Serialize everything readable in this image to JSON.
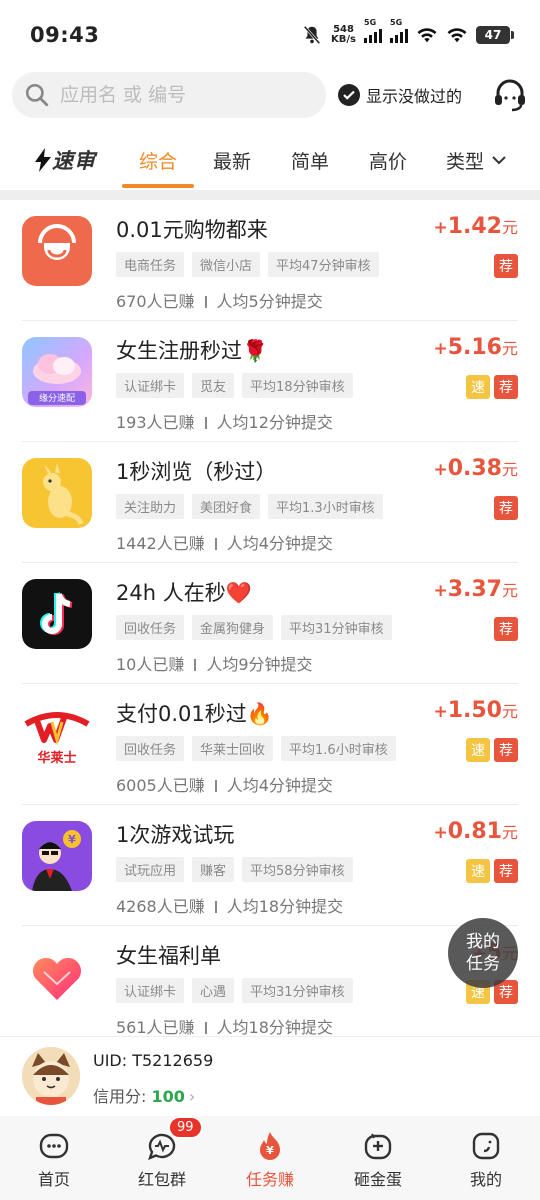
{
  "status_bar": {
    "time": "09:43",
    "speed_value": "548",
    "speed_unit": "KB/s",
    "sig1": "5G",
    "sig2": "5G",
    "battery": "47"
  },
  "search": {
    "placeholder": "应用名 或 编号",
    "toggle_label": "显示没做过的"
  },
  "tabs": {
    "logo": "速审",
    "items": [
      "综合",
      "最新",
      "简单",
      "高价",
      "类型"
    ],
    "active": "综合"
  },
  "tasks": [
    {
      "title": "0.01元购物都来",
      "tags": [
        "电商任务",
        "微信小店",
        "平均47分钟审核"
      ],
      "earned": "670人已赚",
      "avg": "人均5分钟提交",
      "plus": "+",
      "price": "1.42",
      "unit": "元",
      "fast": false,
      "rec": "荐",
      "icon": "shop-icon",
      "color": "#ef6a4c"
    },
    {
      "title": "女生注册秒过🌹",
      "tags": [
        "认证绑卡",
        "觅友",
        "平均18分钟审核"
      ],
      "earned": "193人已赚",
      "avg": "人均12分钟提交",
      "plus": "+",
      "price": "5.16",
      "unit": "元",
      "fast": true,
      "fast_label": "速",
      "rec": "荐",
      "icon": "cloud-heart-icon",
      "color": "#b7a6f3",
      "icon_caption": "缘分速配"
    },
    {
      "title": "1秒浏览（秒过）",
      "tags": [
        "关注助力",
        "美团好食",
        "平均1.3小时审核"
      ],
      "earned": "1442人已赚",
      "avg": "人均4分钟提交",
      "plus": "+",
      "price": "0.38",
      "unit": "元",
      "fast": false,
      "rec": "荐",
      "icon": "kangaroo-icon",
      "color": "#f7c531"
    },
    {
      "title": "24h 人在秒❤️",
      "tags": [
        "回收任务",
        "金属狗健身",
        "平均31分钟审核"
      ],
      "earned": "10人已赚",
      "avg": "人均9分钟提交",
      "plus": "+",
      "price": "3.37",
      "unit": "元",
      "fast": false,
      "rec": "荐",
      "icon": "tiktok-icon",
      "color": "#111111"
    },
    {
      "title": "支付0.01秒过🔥",
      "tags": [
        "回收任务",
        "华莱士回收",
        "平均1.6小时审核"
      ],
      "earned": "6005人已赚",
      "avg": "人均4分钟提交",
      "plus": "+",
      "price": "1.50",
      "unit": "元",
      "fast": true,
      "fast_label": "速",
      "rec": "荐",
      "icon": "wallace-icon",
      "color": "#ffffff",
      "icon_caption": "华莱士"
    },
    {
      "title": "1次游戏试玩",
      "tags": [
        "试玩应用",
        "赚客",
        "平均58分钟审核"
      ],
      "earned": "4268人已赚",
      "avg": "人均18分钟提交",
      "plus": "+",
      "price": "0.81",
      "unit": "元",
      "fast": true,
      "fast_label": "速",
      "rec": "荐",
      "icon": "gamer-icon",
      "color": "#8a4be0"
    },
    {
      "title": "女生福利单",
      "tags": [
        "认证绑卡",
        "心遇",
        "平均31分钟审核"
      ],
      "earned": "561人已赚",
      "avg": "人均18分钟提交",
      "plus": "+",
      "price": "5",
      "unit": "元",
      "fast": true,
      "fast_label": "速",
      "rec": "荐",
      "icon": "heart-icon",
      "color": "#ffffff"
    }
  ],
  "fab": {
    "line1": "我的",
    "line2": "任务"
  },
  "user": {
    "uid": "UID: T5212659",
    "credit_label": "信用分: ",
    "credit_value": "100"
  },
  "nav": {
    "items": [
      "首页",
      "红包群",
      "任务赚",
      "砸金蛋",
      "我的"
    ],
    "badge": "99",
    "active": "任务赚"
  },
  "colors": {
    "accent": "#f08a24",
    "price": "#e8553d",
    "fast": "#f4c542",
    "credit": "#2aa64d"
  }
}
